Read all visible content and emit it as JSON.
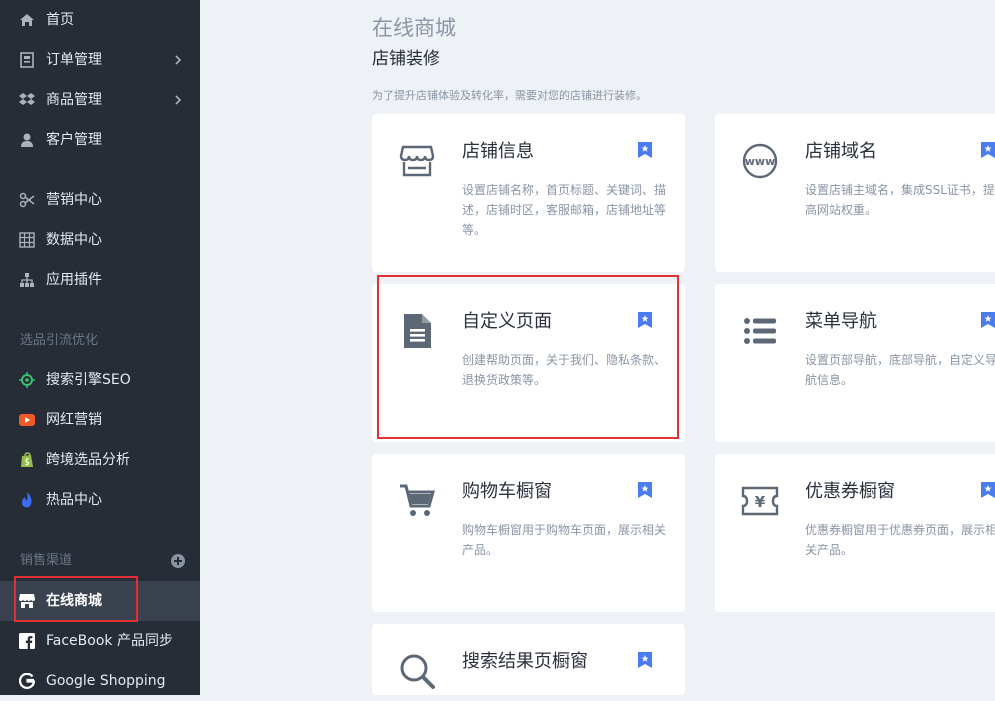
{
  "sidebar": {
    "items": [
      {
        "label": "首页",
        "icon": "home-icon"
      },
      {
        "label": "订单管理",
        "icon": "order-icon"
      },
      {
        "label": "商品管理",
        "icon": "product-icon"
      },
      {
        "label": "客户管理",
        "icon": "customer-icon"
      },
      {
        "label": "营销中心",
        "icon": "scissors-icon"
      },
      {
        "label": "数据中心",
        "icon": "data-grid-icon"
      },
      {
        "label": "应用插件",
        "icon": "sitemap-icon"
      }
    ],
    "group1_label": "选品引流优化",
    "group1_items": [
      {
        "label": "搜索引擎SEO",
        "icon": "seo-icon"
      },
      {
        "label": "网红营销",
        "icon": "youtube-icon"
      },
      {
        "label": "跨境选品分析",
        "icon": "shopify-icon"
      },
      {
        "label": "热品中心",
        "icon": "fire-icon"
      }
    ],
    "group2_label": "销售渠道",
    "group2_items": [
      {
        "label": "在线商城",
        "icon": "store-icon"
      },
      {
        "label": "FaceBook 产品同步",
        "icon": "facebook-icon"
      },
      {
        "label": "Google Shopping",
        "icon": "google-icon"
      }
    ],
    "colors": {
      "bg": "#262d37",
      "active": "#3a4250",
      "highlight": "#e03030",
      "youtube": "#f05a28",
      "shopify": "#95bf47",
      "fire": "#3b6cf5",
      "seo": "#3fbf6f"
    }
  },
  "main": {
    "page_title": "在线商城",
    "section_title": "店铺装修",
    "description": "为了提升店铺体验及转化率，需要对您的店铺进行装修。",
    "cards": [
      {
        "title": "店铺信息",
        "desc": "设置店铺名称，首页标题、关键词、描述，店铺时区，客服邮箱，店铺地址等等。",
        "icon": "store-icon"
      },
      {
        "title": "店铺域名",
        "desc_lines": [
          "设置店铺主域名，集成SSL证书，提",
          "高网站权重。"
        ],
        "icon": "www-icon"
      },
      {
        "title": "自定义页面",
        "desc": "创建帮助页面，关于我们、隐私条款、退换货政策等。",
        "icon": "document-icon"
      },
      {
        "title": "菜单导航",
        "desc_lines": [
          "设置页部导航，底部导航，自定义导",
          "航信息。"
        ],
        "icon": "list-icon"
      },
      {
        "title": "购物车橱窗",
        "desc": "购物车橱窗用于购物车页面，展示相关产品。",
        "icon": "cart-icon"
      },
      {
        "title": "优惠券橱窗",
        "desc_lines": [
          "优惠券橱窗用于优惠券页面，展示相",
          "关产品。"
        ],
        "icon": "coupon-icon"
      },
      {
        "title": "搜索结果页橱窗",
        "desc": "",
        "icon": "search-icon"
      }
    ],
    "colors": {
      "bookmark": "#4a7cf0",
      "icon": "#5d6876"
    }
  }
}
